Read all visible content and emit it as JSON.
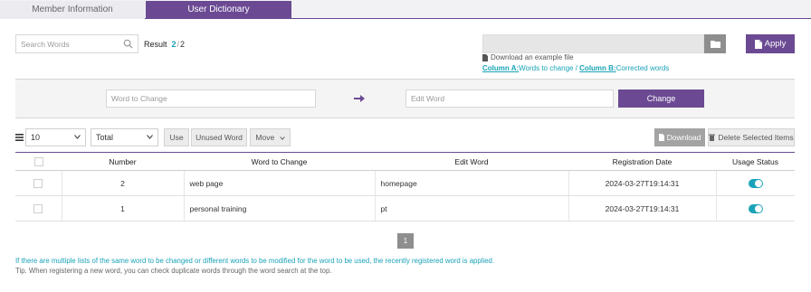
{
  "tabs": [
    {
      "label": "Member Information"
    },
    {
      "label": "User Dictionary"
    }
  ],
  "search": {
    "placeholder": "Search Words"
  },
  "result": {
    "label": "Result",
    "current": "2",
    "separator": "/",
    "total": "2"
  },
  "upload": {
    "apply_label": "Apply",
    "download_example": "Download an example file",
    "column_a_label": "Column A:",
    "column_a_text": "Words to change",
    "column_sep": " / ",
    "column_b_label": "Column B:",
    "column_b_text": "Corrected words"
  },
  "change_panel": {
    "word_placeholder": "Word to Change",
    "edit_placeholder": "Edit Word",
    "change_label": "Change"
  },
  "toolbar": {
    "page_size": "10",
    "filter": "Total",
    "use_label": "Use",
    "unused_label": "Unused Word",
    "move_label": "Move",
    "download_label": "Download",
    "delete_label": "Delete Selected Items"
  },
  "table": {
    "headers": [
      "Number",
      "Word to Change",
      "Edit Word",
      "Registration Date",
      "Usage Status"
    ],
    "rows": [
      {
        "number": "2",
        "word": "web page",
        "edit": "homepage",
        "date": "2024-03-27T19:14:31"
      },
      {
        "number": "1",
        "word": "personal training",
        "edit": "pt",
        "date": "2024-03-27T19:14:31"
      }
    ]
  },
  "pagination": {
    "current": "1"
  },
  "notes": {
    "info": "If there are multiple lists of the same word to be changed or different words to be modified for the word to be used, the recently registered word is applied.",
    "tip": "Tip. When registering a new word, you can check duplicate words through the word search at the top."
  },
  "colors": {
    "accent": "#6b4a93",
    "teal": "#1aa3b8"
  }
}
